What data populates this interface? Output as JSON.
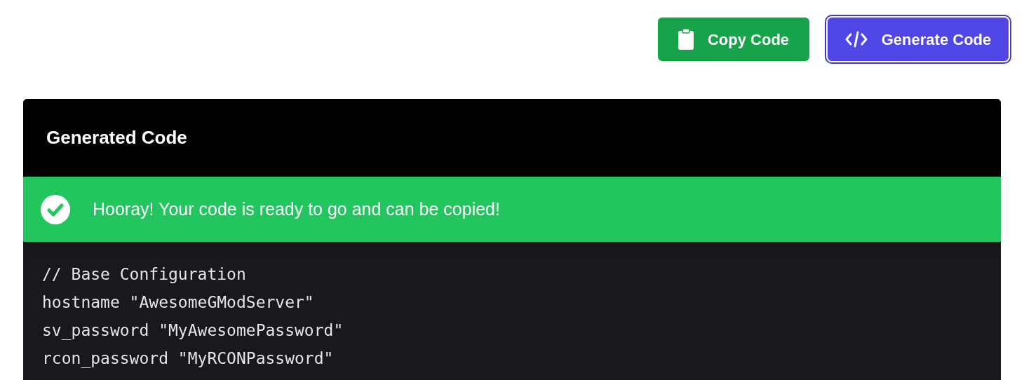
{
  "buttons": [
    {
      "kind": "copy",
      "label": "Copy Code",
      "focused": false
    },
    {
      "kind": "generate",
      "label": "Generate Code",
      "focused": true
    }
  ],
  "panel": {
    "title": "Generated Code",
    "alert": {
      "message": "Hooray! Your code is ready to go and can be copied!"
    },
    "code_lines": [
      "// Base Configuration",
      "hostname \"AwesomeGModServer\"",
      "sv_password \"MyAwesomePassword\"",
      "rcon_password \"MyRCONPassword\""
    ]
  }
}
